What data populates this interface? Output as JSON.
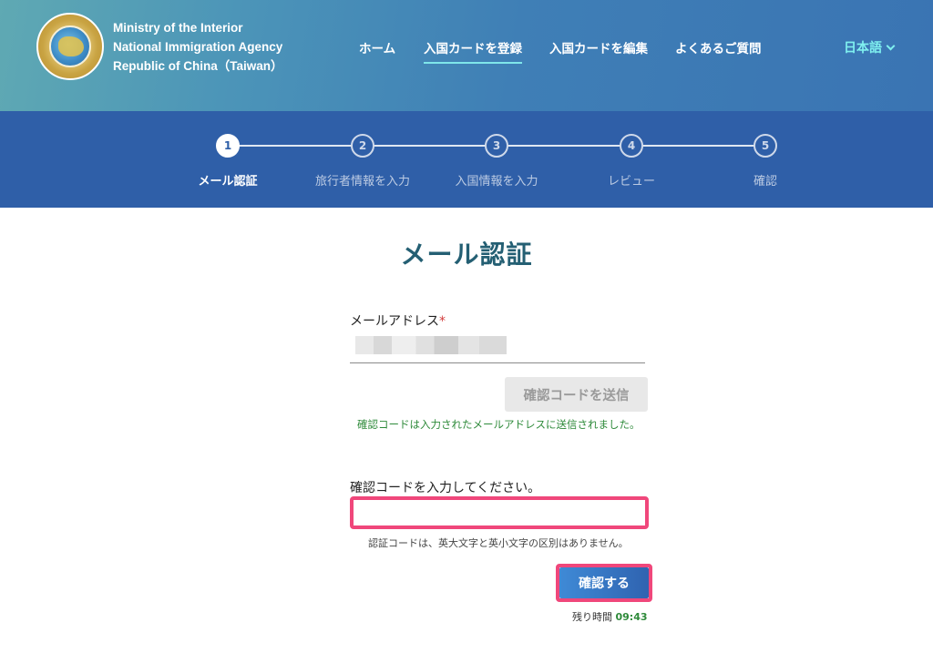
{
  "header": {
    "agency_lines": [
      "Ministry of the Interior",
      "National Immigration Agency",
      "Republic of China（Taiwan）"
    ],
    "nav": [
      {
        "label": "ホーム",
        "active": false
      },
      {
        "label": "入国カードを登録",
        "active": true
      },
      {
        "label": "入国カードを編集",
        "active": false
      },
      {
        "label": "よくあるご質問",
        "active": false
      }
    ],
    "language": "日本語",
    "icons": {
      "logo": "agency-seal-icon",
      "lang": "chevron-down-icon"
    },
    "colors": {
      "accent": "#7ff0ef"
    }
  },
  "stepper": {
    "steps": [
      {
        "num": "1",
        "label": "メール認証",
        "active": true
      },
      {
        "num": "2",
        "label": "旅行者情報を入力",
        "active": false
      },
      {
        "num": "3",
        "label": "入国情報を入力",
        "active": false
      },
      {
        "num": "4",
        "label": "レビュー",
        "active": false
      },
      {
        "num": "5",
        "label": "確認",
        "active": false
      }
    ],
    "colors": {
      "band": "#2f5fa8"
    }
  },
  "main": {
    "title": "メール認証",
    "email_label": "メールアドレス",
    "required_mark": "*",
    "send_code_button": "確認コードを送信",
    "sent_message": "確認コードは入力されたメールアドレスに送信されました。",
    "code_label": "確認コードを入力してください。",
    "code_value": "",
    "case_note": "認証コードは、英大文字と英小文字の区別はありません。",
    "confirm_button": "確認する",
    "remaining_label": "残り時間",
    "remaining_time": "09:43",
    "colors": {
      "highlight": "#f0477b",
      "success": "#2e8a3a",
      "title": "#245f73"
    }
  }
}
